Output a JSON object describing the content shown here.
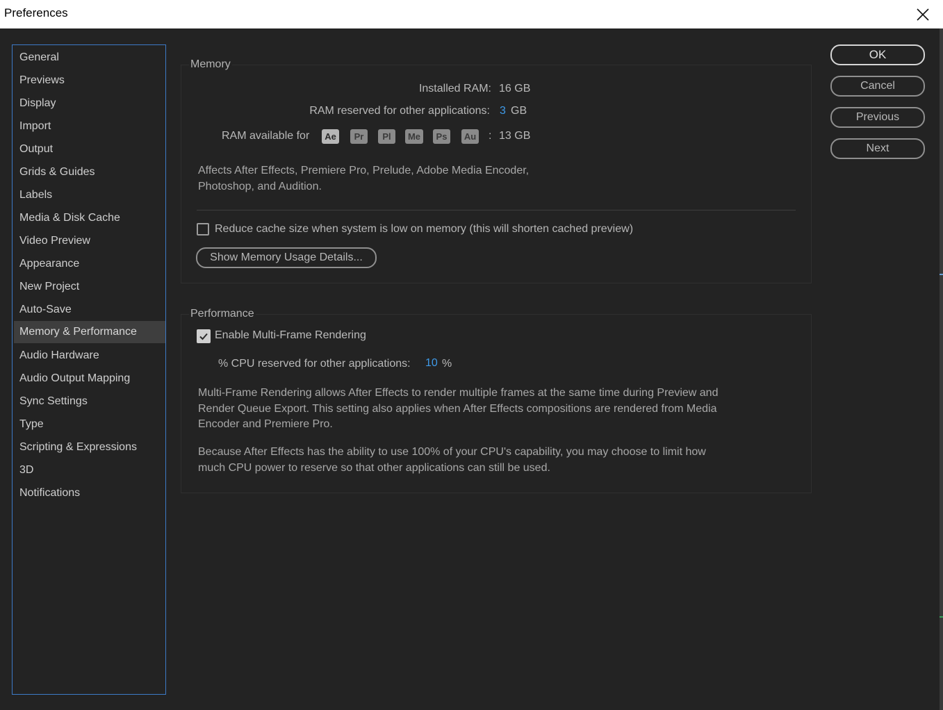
{
  "window": {
    "title": "Preferences",
    "close_icon": "close-icon"
  },
  "sidebar": {
    "items": [
      {
        "label": "General"
      },
      {
        "label": "Previews"
      },
      {
        "label": "Display"
      },
      {
        "label": "Import"
      },
      {
        "label": "Output"
      },
      {
        "label": "Grids & Guides"
      },
      {
        "label": "Labels"
      },
      {
        "label": "Media & Disk Cache"
      },
      {
        "label": "Video Preview"
      },
      {
        "label": "Appearance"
      },
      {
        "label": "New Project"
      },
      {
        "label": "Auto-Save"
      },
      {
        "label": "Memory & Performance",
        "selected": true
      },
      {
        "label": "Audio Hardware"
      },
      {
        "label": "Audio Output Mapping"
      },
      {
        "label": "Sync Settings"
      },
      {
        "label": "Type"
      },
      {
        "label": "Scripting & Expressions"
      },
      {
        "label": "3D"
      },
      {
        "label": "Notifications"
      }
    ]
  },
  "memory": {
    "title": "Memory",
    "installed_label": "Installed RAM:",
    "installed_value": "16 GB",
    "reserved_label": "RAM reserved for other applications:",
    "reserved_value": "3",
    "reserved_unit": "GB",
    "available_label": "RAM available for",
    "apps": [
      "Ae",
      "Pr",
      "Pl",
      "Me",
      "Ps",
      "Au"
    ],
    "available_sep": ":",
    "available_value": "13 GB",
    "affects_line1": "Affects After Effects, Premiere Pro, Prelude, Adobe Media Encoder,",
    "affects_line2": "Photoshop, and Audition.",
    "reduce_cache_label": "Reduce cache size when system is low on memory (this will shorten cached preview)",
    "reduce_cache_checked": false,
    "show_details_label": "Show Memory Usage Details..."
  },
  "performance": {
    "title": "Performance",
    "mfr_label": "Enable Multi-Frame Rendering",
    "mfr_checked": true,
    "cpu_label": "% CPU reserved for other applications:",
    "cpu_value": "10",
    "cpu_unit": "%",
    "desc1_line1": "Multi-Frame Rendering allows After Effects to render multiple frames at the same time during Preview and",
    "desc1_line2": "Render Queue Export. This setting also applies when After Effects compositions are rendered from Media",
    "desc1_line3": "Encoder and Premiere Pro.",
    "desc2_line1": "Because After Effects has the ability to use 100% of your CPU's capability, you may choose to limit how",
    "desc2_line2": "much CPU power to reserve so that other applications can still be used."
  },
  "buttons": {
    "ok": "OK",
    "cancel": "Cancel",
    "previous": "Previous",
    "next": "Next"
  }
}
